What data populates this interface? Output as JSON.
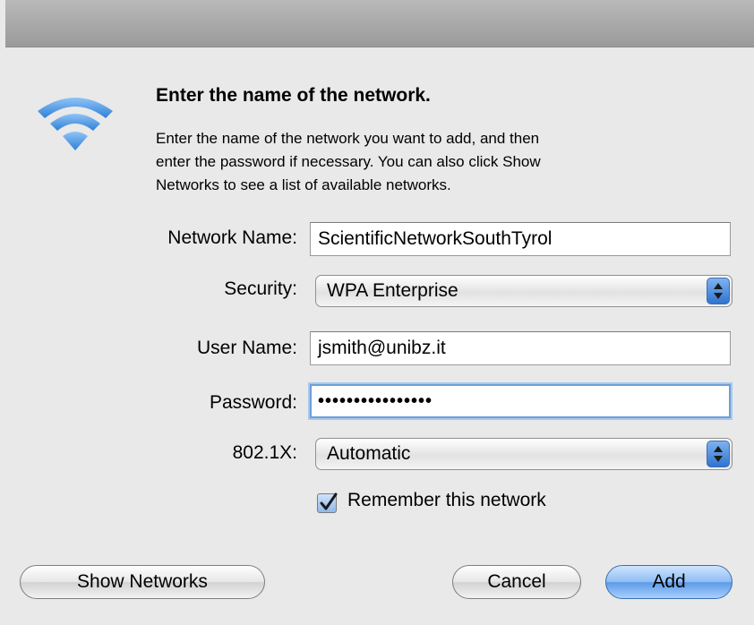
{
  "dialog": {
    "heading": "Enter the name of the network.",
    "description_lines": [
      "Enter the name of the network you want to add, and then",
      "enter the password if necessary. You can also click Show",
      "Networks to see a list of available networks."
    ],
    "icon": "wifi-icon"
  },
  "form": {
    "network_name_label": "Network Name:",
    "network_name_value": "ScientificNetworkSouthTyrol",
    "security_label": "Security:",
    "security_value": "WPA Enterprise",
    "user_name_label": "User Name:",
    "user_name_value": "jsmith@unibz.it",
    "password_label": "Password:",
    "password_value": "••••••••••••••••",
    "eap_label": "802.1X:",
    "eap_value": "Automatic",
    "remember_label": "Remember this network",
    "remember_checked": true
  },
  "buttons": {
    "show_networks": "Show Networks",
    "cancel": "Cancel",
    "add": "Add"
  },
  "colors": {
    "accent": "#5b9be6",
    "focus_ring": "#a9c8ec",
    "wifi": "#3b8de0"
  }
}
